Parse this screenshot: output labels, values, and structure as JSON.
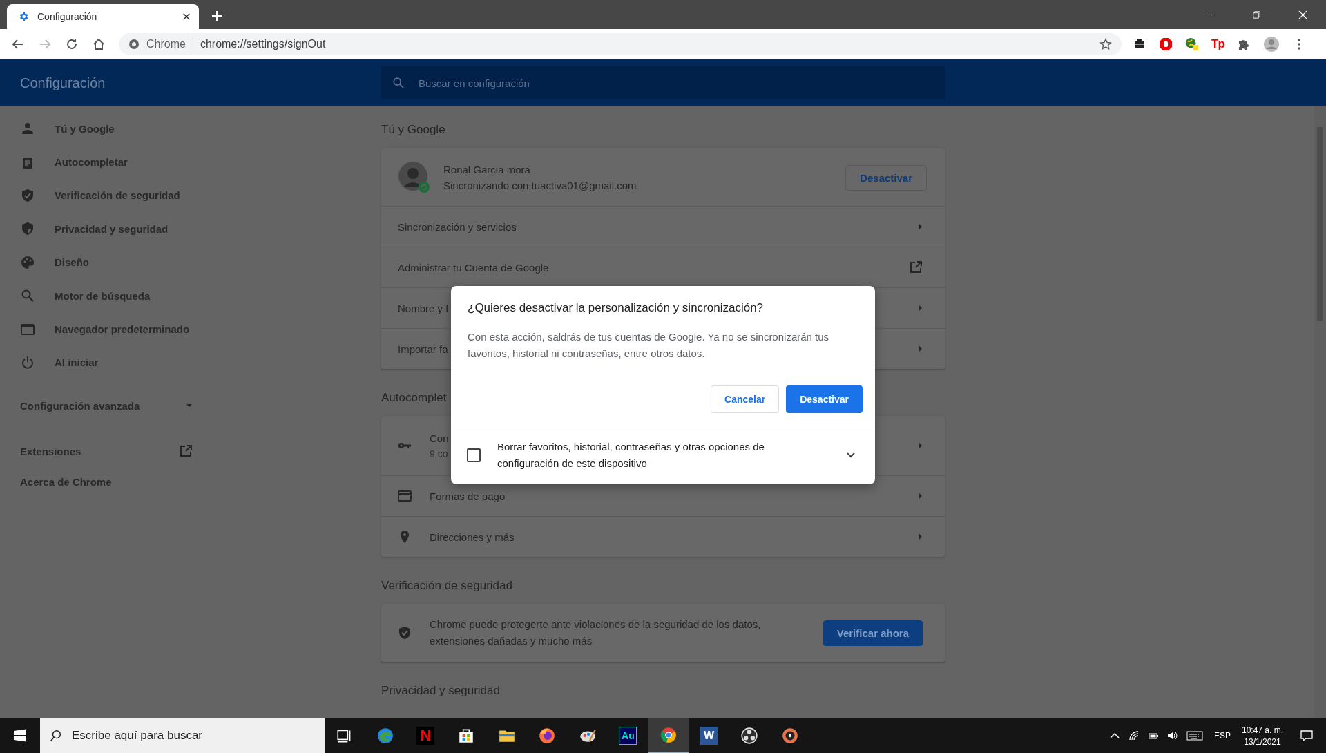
{
  "browser": {
    "tab": {
      "title": "Configuración",
      "selected": true
    },
    "omnibox": {
      "origin": "Chrome",
      "url": "chrome://settings/signOut"
    },
    "forward_disabled": true,
    "extensions": [
      {
        "kind": "briefcase"
      },
      {
        "kind": "stop"
      },
      {
        "kind": "globe"
      },
      {
        "kind": "text",
        "label": "Tp"
      },
      {
        "kind": "puzzle"
      }
    ]
  },
  "header": {
    "title": "Configuración",
    "search": {
      "placeholder": "Buscar en configuración"
    }
  },
  "sidebar": {
    "items": [
      {
        "label": "Tú y Google"
      },
      {
        "label": "Autocompletar"
      },
      {
        "label": "Verificación de seguridad"
      },
      {
        "label": "Privacidad y seguridad"
      },
      {
        "label": "Diseño"
      },
      {
        "label": "Motor de búsqueda"
      },
      {
        "label": "Navegador predeterminado"
      },
      {
        "label": "Al iniciar"
      }
    ],
    "advanced": {
      "label": "Configuración avanzada",
      "expanded": false
    },
    "extensions": "Extensiones",
    "about": "Acerca de Chrome"
  },
  "sections": [
    {
      "title": "Tú y Google",
      "profile": {
        "name": "Ronal Garcia mora",
        "email": "Sincronizando con tuactiva01@gmail.com",
        "button": "Desactivar"
      },
      "rows": [
        {
          "label": "Sincronización y servicios",
          "kind": "arrow"
        },
        {
          "label": "Administrar tu Cuenta de Google",
          "kind": "external"
        },
        {
          "label": "Nombre y f",
          "kind": "arrow"
        },
        {
          "label": "Importar fa",
          "kind": "arrow"
        }
      ]
    },
    {
      "title": "Autocomplet",
      "rows": [
        {
          "label": "Con",
          "sub": "9 co",
          "kind": "arrow"
        },
        {
          "label": "Formas de pago",
          "kind": "arrow"
        },
        {
          "label": "Direcciones y más",
          "kind": "arrow"
        }
      ]
    },
    {
      "title": "Verificación de seguridad",
      "check": {
        "text": "Chrome puede protegerte ante violaciones de la seguridad de los datos, extensiones dañadas y mucho más",
        "button": "Verificar ahora"
      }
    },
    {
      "title": "Privacidad y seguridad"
    }
  ],
  "dialog": {
    "title": "¿Quieres desactivar la personalización y sincronización?",
    "body": "Con esta acción, saldrás de tus cuentas de Google. Ya no se sincronizarán tus favoritos, historial ni contraseñas, entre otros datos.",
    "cancel": "Cancelar",
    "confirm": "Desactivar",
    "option": {
      "label": "Borrar favoritos, historial, contraseñas y otras opciones de configuración de este dispositivo",
      "checked": false,
      "expanded": false
    }
  },
  "taskbar": {
    "search": {
      "placeholder": "Escribe aquí para buscar"
    },
    "apps": [
      {
        "kind": "taskview",
        "selected": false
      },
      {
        "kind": "edge",
        "selected": false
      },
      {
        "kind": "netflix",
        "label": "N",
        "selected": false
      },
      {
        "kind": "store",
        "selected": false
      },
      {
        "kind": "folder",
        "selected": false
      },
      {
        "kind": "firefox",
        "selected": false
      },
      {
        "kind": "paint",
        "selected": false
      },
      {
        "kind": "audition",
        "label": "Au",
        "selected": false
      },
      {
        "kind": "chrome",
        "selected": true
      },
      {
        "kind": "word",
        "label": "W",
        "selected": false
      },
      {
        "kind": "obs",
        "selected": false
      },
      {
        "kind": "disc",
        "selected": false
      }
    ],
    "language": "ESP",
    "time": "10:47 a. m.",
    "date": "13/1/2021"
  }
}
